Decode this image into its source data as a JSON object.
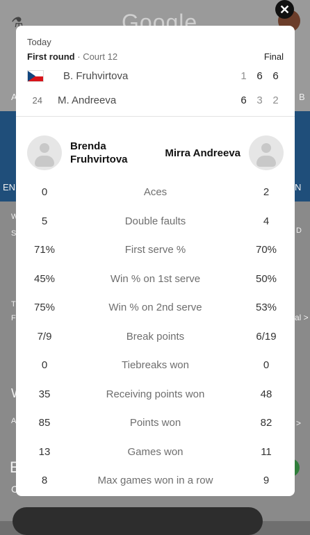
{
  "background": {
    "logo_text": "Google",
    "left_edge_texts": [
      "A",
      "EN",
      "W",
      "S",
      "T",
      "F",
      "W",
      "A",
      "E",
      "C"
    ],
    "right_edge_texts": [
      "B",
      "N",
      "D",
      "al >",
      ">"
    ]
  },
  "match": {
    "date": "Today",
    "round": "First round",
    "court": "Court 12",
    "status": "Final",
    "player1": {
      "name": "B. Fruhvirtova",
      "seed": "",
      "country_flag": "czech-flag",
      "sets": [
        "1",
        "6",
        "6"
      ]
    },
    "player2": {
      "name": "M. Andreeva",
      "seed": "24",
      "sets": [
        "6",
        "3",
        "2"
      ]
    }
  },
  "players_panel": {
    "player1_name": "Brenda Fruhvirtova",
    "player2_name": "Mirra Andreeva"
  },
  "stats": [
    {
      "label": "Aces",
      "p1": "0",
      "p2": "2"
    },
    {
      "label": "Double faults",
      "p1": "5",
      "p2": "4"
    },
    {
      "label": "First serve %",
      "p1": "71%",
      "p2": "70%"
    },
    {
      "label": "Win % on 1st serve",
      "p1": "45%",
      "p2": "50%"
    },
    {
      "label": "Win % on 2nd serve",
      "p1": "75%",
      "p2": "53%"
    },
    {
      "label": "Break points",
      "p1": "7/9",
      "p2": "6/19"
    },
    {
      "label": "Tiebreaks won",
      "p1": "0",
      "p2": "0"
    },
    {
      "label": "Receiving points won",
      "p1": "35",
      "p2": "48"
    },
    {
      "label": "Points won",
      "p1": "85",
      "p2": "82"
    },
    {
      "label": "Games won",
      "p1": "13",
      "p2": "11"
    },
    {
      "label": "Max games won in a row",
      "p1": "8",
      "p2": "9"
    }
  ],
  "close_icon": "close-icon"
}
